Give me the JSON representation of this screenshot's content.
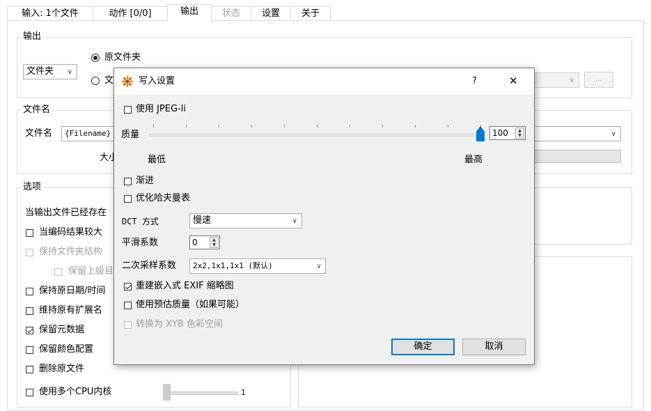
{
  "tabs": [
    {
      "label": "输入: 1个文件",
      "state": "normal"
    },
    {
      "label": "动作 [0/0]",
      "state": "normal"
    },
    {
      "label": "输出",
      "state": "active"
    },
    {
      "label": "状态",
      "state": "disabled"
    },
    {
      "label": "设置",
      "state": "normal"
    },
    {
      "label": "关于",
      "state": "normal"
    }
  ],
  "output_group": {
    "title": "输出",
    "folder_combo": "文件夹",
    "radio_original": "原文件夹",
    "radio_other": "文",
    "browse_label": "..."
  },
  "filename_group": {
    "title": "文件名",
    "label": "文件名",
    "value": "{Filename}",
    "size_label": "大小"
  },
  "options_group": {
    "title": "选项",
    "exists_label": "当输出文件已经存在",
    "items": [
      {
        "label": "当编码结果较大",
        "checked": false,
        "disabled": false
      },
      {
        "label": "保持文件夹结构",
        "checked": false,
        "disabled": true
      },
      {
        "label": "保留上级目",
        "checked": false,
        "disabled": true
      },
      {
        "label": "保持原日期/时间",
        "checked": false,
        "disabled": false
      },
      {
        "label": "维持原有扩展名",
        "checked": false,
        "disabled": false
      },
      {
        "label": "保留元数据",
        "checked": true,
        "disabled": false
      },
      {
        "label": "保留颜色配置",
        "checked": false,
        "disabled": false
      },
      {
        "label": "删除原文件",
        "checked": false,
        "disabled": false
      },
      {
        "label": "使用多个CPU内核",
        "checked": false,
        "disabled": false
      }
    ],
    "cpu_value": "1"
  },
  "dialog": {
    "title": "写入设置",
    "help_label": "?",
    "close_label": "✕",
    "use_jpegli": "使用 JPEG-li",
    "quality_label": "质量",
    "quality_value": "100",
    "quality_fraction": 1.0,
    "min_label": "最低",
    "max_label": "最高",
    "progressive": "渐进",
    "optimize_huffman": "优化哈夫曼表",
    "dct_label": "DCT 方式",
    "dct_value": "慢速",
    "smooth_label": "平滑系数",
    "smooth_value": "0",
    "subsampling_label": "二次采样系数",
    "subsampling_value": "2x2,1x1,1x1 (默认)",
    "rebuild_exif": "重建嵌入式 EXIF 缩略图",
    "use_estimated": "使用预估质量（如果可能）",
    "convert_xyb": "转换为 XYB 色彩空间",
    "ok_label": "确定",
    "cancel_label": "取消"
  }
}
